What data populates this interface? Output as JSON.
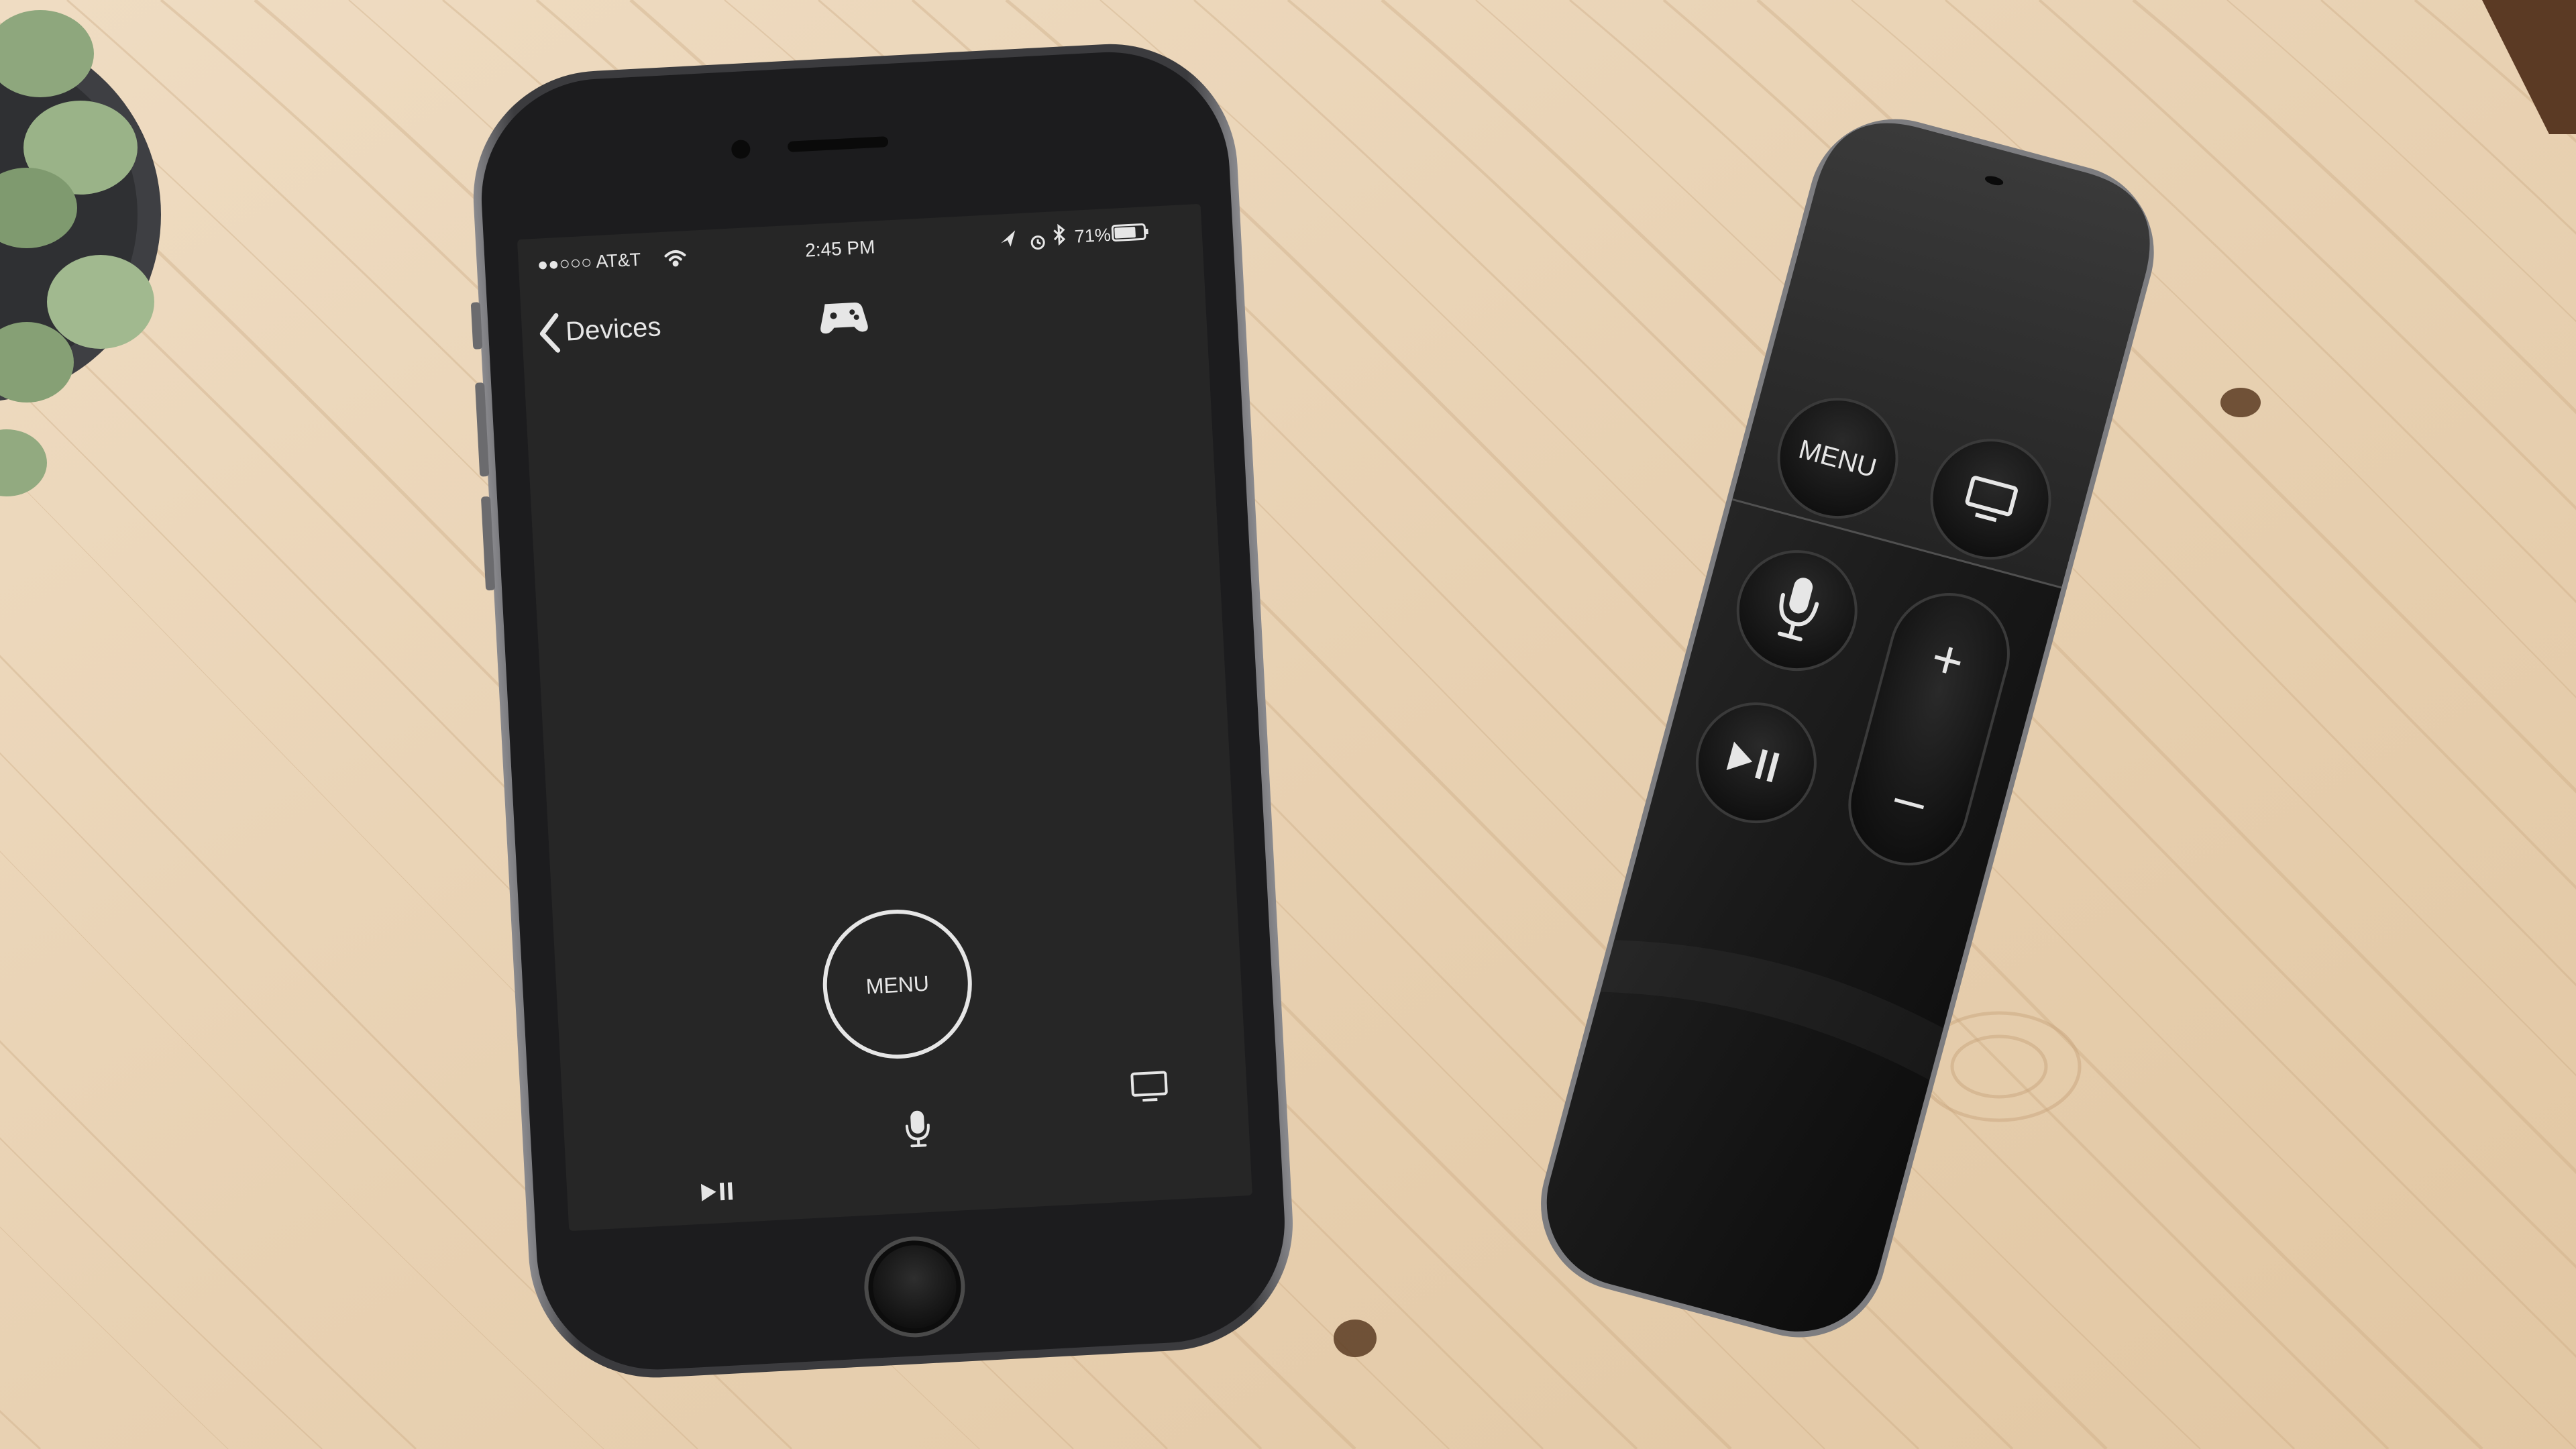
{
  "phone": {
    "status_bar": {
      "carrier": "●●○○○ AT&T",
      "time": "2:45 PM",
      "battery": "71%"
    },
    "nav": {
      "back_label": "Devices"
    },
    "remote_app": {
      "menu_label": "MENU"
    },
    "icons": {
      "wifi": "wifi-icon",
      "location": "location-arrow-icon",
      "alarm": "alarm-icon",
      "bluetooth": "bluetooth-icon",
      "battery": "battery-icon",
      "game_controller": "game-controller-icon",
      "back_chevron": "chevron-left-icon",
      "play_pause": "play-pause-icon",
      "microphone": "microphone-icon",
      "tv": "tv-icon"
    }
  },
  "siri_remote": {
    "menu_label": "MENU",
    "volume_up": "+",
    "volume_down": "–"
  },
  "colors": {
    "wood": "#e9d4b7",
    "phone_screen": "#262626",
    "phone_body": "#3a3a3c",
    "remote_body": "#111111",
    "ui_white": "#e6e6e6"
  }
}
